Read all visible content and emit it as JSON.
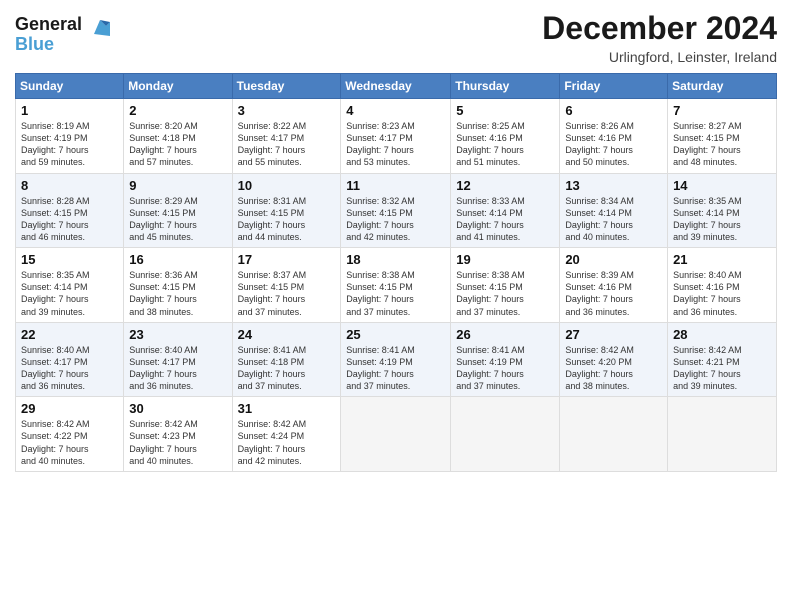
{
  "header": {
    "logo_line1": "General",
    "logo_line2": "Blue",
    "month_title": "December 2024",
    "location": "Urlingford, Leinster, Ireland"
  },
  "days_of_week": [
    "Sunday",
    "Monday",
    "Tuesday",
    "Wednesday",
    "Thursday",
    "Friday",
    "Saturday"
  ],
  "weeks": [
    [
      {
        "day": "1",
        "sunrise": "8:19 AM",
        "sunset": "4:19 PM",
        "daylight": "7 hours and 59 minutes."
      },
      {
        "day": "2",
        "sunrise": "8:20 AM",
        "sunset": "4:18 PM",
        "daylight": "7 hours and 57 minutes."
      },
      {
        "day": "3",
        "sunrise": "8:22 AM",
        "sunset": "4:17 PM",
        "daylight": "7 hours and 55 minutes."
      },
      {
        "day": "4",
        "sunrise": "8:23 AM",
        "sunset": "4:17 PM",
        "daylight": "7 hours and 53 minutes."
      },
      {
        "day": "5",
        "sunrise": "8:25 AM",
        "sunset": "4:16 PM",
        "daylight": "7 hours and 51 minutes."
      },
      {
        "day": "6",
        "sunrise": "8:26 AM",
        "sunset": "4:16 PM",
        "daylight": "7 hours and 50 minutes."
      },
      {
        "day": "7",
        "sunrise": "8:27 AM",
        "sunset": "4:15 PM",
        "daylight": "7 hours and 48 minutes."
      }
    ],
    [
      {
        "day": "8",
        "sunrise": "8:28 AM",
        "sunset": "4:15 PM",
        "daylight": "7 hours and 46 minutes."
      },
      {
        "day": "9",
        "sunrise": "8:29 AM",
        "sunset": "4:15 PM",
        "daylight": "7 hours and 45 minutes."
      },
      {
        "day": "10",
        "sunrise": "8:31 AM",
        "sunset": "4:15 PM",
        "daylight": "7 hours and 44 minutes."
      },
      {
        "day": "11",
        "sunrise": "8:32 AM",
        "sunset": "4:15 PM",
        "daylight": "7 hours and 42 minutes."
      },
      {
        "day": "12",
        "sunrise": "8:33 AM",
        "sunset": "4:14 PM",
        "daylight": "7 hours and 41 minutes."
      },
      {
        "day": "13",
        "sunrise": "8:34 AM",
        "sunset": "4:14 PM",
        "daylight": "7 hours and 40 minutes."
      },
      {
        "day": "14",
        "sunrise": "8:35 AM",
        "sunset": "4:14 PM",
        "daylight": "7 hours and 39 minutes."
      }
    ],
    [
      {
        "day": "15",
        "sunrise": "8:35 AM",
        "sunset": "4:14 PM",
        "daylight": "7 hours and 39 minutes."
      },
      {
        "day": "16",
        "sunrise": "8:36 AM",
        "sunset": "4:15 PM",
        "daylight": "7 hours and 38 minutes."
      },
      {
        "day": "17",
        "sunrise": "8:37 AM",
        "sunset": "4:15 PM",
        "daylight": "7 hours and 37 minutes."
      },
      {
        "day": "18",
        "sunrise": "8:38 AM",
        "sunset": "4:15 PM",
        "daylight": "7 hours and 37 minutes."
      },
      {
        "day": "19",
        "sunrise": "8:38 AM",
        "sunset": "4:15 PM",
        "daylight": "7 hours and 37 minutes."
      },
      {
        "day": "20",
        "sunrise": "8:39 AM",
        "sunset": "4:16 PM",
        "daylight": "7 hours and 36 minutes."
      },
      {
        "day": "21",
        "sunrise": "8:40 AM",
        "sunset": "4:16 PM",
        "daylight": "7 hours and 36 minutes."
      }
    ],
    [
      {
        "day": "22",
        "sunrise": "8:40 AM",
        "sunset": "4:17 PM",
        "daylight": "7 hours and 36 minutes."
      },
      {
        "day": "23",
        "sunrise": "8:40 AM",
        "sunset": "4:17 PM",
        "daylight": "7 hours and 36 minutes."
      },
      {
        "day": "24",
        "sunrise": "8:41 AM",
        "sunset": "4:18 PM",
        "daylight": "7 hours and 37 minutes."
      },
      {
        "day": "25",
        "sunrise": "8:41 AM",
        "sunset": "4:19 PM",
        "daylight": "7 hours and 37 minutes."
      },
      {
        "day": "26",
        "sunrise": "8:41 AM",
        "sunset": "4:19 PM",
        "daylight": "7 hours and 37 minutes."
      },
      {
        "day": "27",
        "sunrise": "8:42 AM",
        "sunset": "4:20 PM",
        "daylight": "7 hours and 38 minutes."
      },
      {
        "day": "28",
        "sunrise": "8:42 AM",
        "sunset": "4:21 PM",
        "daylight": "7 hours and 39 minutes."
      }
    ],
    [
      {
        "day": "29",
        "sunrise": "8:42 AM",
        "sunset": "4:22 PM",
        "daylight": "7 hours and 40 minutes."
      },
      {
        "day": "30",
        "sunrise": "8:42 AM",
        "sunset": "4:23 PM",
        "daylight": "7 hours and 40 minutes."
      },
      {
        "day": "31",
        "sunrise": "8:42 AM",
        "sunset": "4:24 PM",
        "daylight": "7 hours and 42 minutes."
      },
      null,
      null,
      null,
      null
    ]
  ]
}
